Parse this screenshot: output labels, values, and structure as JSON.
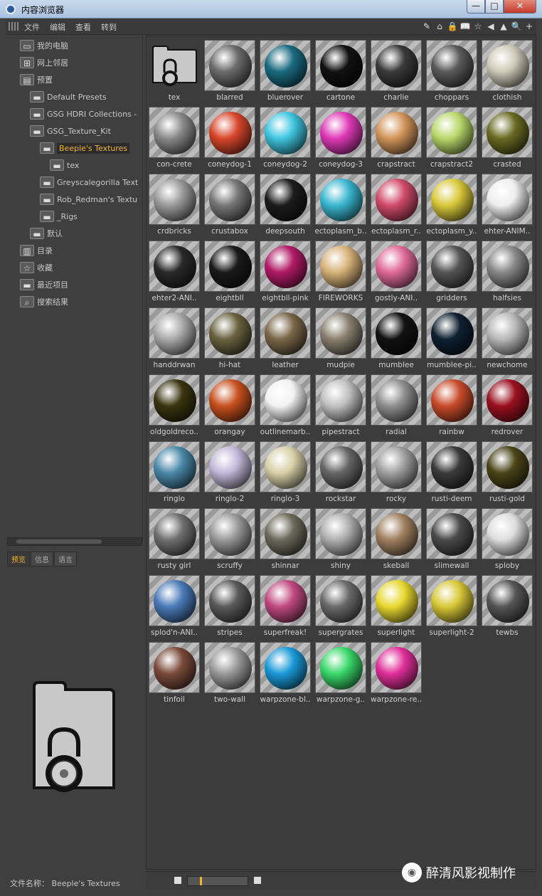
{
  "window": {
    "title": "内容浏览器",
    "min": "—",
    "max": "□",
    "close": "✕"
  },
  "menu": [
    "文件",
    "编辑",
    "查看",
    "转到"
  ],
  "toolbar_icons": [
    "edit-icon",
    "home-icon",
    "lock-icon",
    "book-icon",
    "star-icon",
    "back-icon",
    "up-icon",
    "search-icon",
    "new-icon"
  ],
  "toolbar_glyphs": [
    "✎",
    "⌂",
    "🔒",
    "📖",
    "☆",
    "◀",
    "▲",
    "🔍",
    "+"
  ],
  "tree": [
    {
      "label": "我的电脑",
      "level": 0,
      "icon": "computer-icon"
    },
    {
      "label": "网上邻居",
      "level": 0,
      "icon": "network-icon"
    },
    {
      "label": "预置",
      "level": 0,
      "icon": "presets-icon"
    },
    {
      "label": "Default Presets",
      "level": 1,
      "icon": "folder-icon"
    },
    {
      "label": "GSG HDRI Collections -",
      "level": 1,
      "icon": "folder-icon"
    },
    {
      "label": "GSG_Texture_Kit",
      "level": 1,
      "icon": "folder-icon"
    },
    {
      "label": "Beeple's Textures",
      "level": 2,
      "icon": "folder-icon",
      "selected": true
    },
    {
      "label": "tex",
      "level": 3,
      "icon": "folder-icon"
    },
    {
      "label": "Greyscalegorilla Text",
      "level": 2,
      "icon": "folder-icon"
    },
    {
      "label": "Rob_Redman's Textu",
      "level": 2,
      "icon": "folder-icon"
    },
    {
      "label": "_Rigs",
      "level": 2,
      "icon": "folder-icon"
    },
    {
      "label": "默认",
      "level": 1,
      "icon": "folder-icon"
    },
    {
      "label": "目录",
      "level": 0,
      "icon": "catalog-icon"
    },
    {
      "label": "收藏",
      "level": 0,
      "icon": "favorites-icon"
    },
    {
      "label": "最近项目",
      "level": 0,
      "icon": "recent-icon"
    },
    {
      "label": "搜索结果",
      "level": 0,
      "icon": "search-results-icon"
    }
  ],
  "tabs": [
    {
      "label": "预览",
      "active": true
    },
    {
      "label": "信息",
      "active": false
    },
    {
      "label": "语言",
      "active": false
    }
  ],
  "file_label": "文件名称：  Beeple's Textures",
  "items": [
    {
      "label": "tex",
      "c": "#cccccc",
      "folder": true
    },
    {
      "label": "blarred",
      "c": "#6b6b6b"
    },
    {
      "label": "bluerover",
      "c": "#1a6a80"
    },
    {
      "label": "cartone",
      "c": "#111111"
    },
    {
      "label": "charlie",
      "c": "#3a3a3a"
    },
    {
      "label": "choppars",
      "c": "#5a5a5a"
    },
    {
      "label": "clothish",
      "c": "#cfc9b8"
    },
    {
      "label": "con-crete",
      "c": "#8a8a8a"
    },
    {
      "label": "coneydog-1",
      "c": "#d8462a"
    },
    {
      "label": "coneydog-2",
      "c": "#3fc6e0"
    },
    {
      "label": "coneydog-3",
      "c": "#e03ab8"
    },
    {
      "label": "crapstract",
      "c": "#d2955a"
    },
    {
      "label": "crapstract2",
      "c": "#b9d86a"
    },
    {
      "label": "crasted",
      "c": "#6a6a22"
    },
    {
      "label": "crdbricks",
      "c": "#9a9a9a"
    },
    {
      "label": "crustabox",
      "c": "#777777"
    },
    {
      "label": "deepsouth",
      "c": "#1c1c1c"
    },
    {
      "label": "ectoplasm_b..",
      "c": "#3ab7d0"
    },
    {
      "label": "ectoplasm_r..",
      "c": "#d04a6a"
    },
    {
      "label": "ectoplasm_y..",
      "c": "#d8c83a"
    },
    {
      "label": "ehter-ANIM..",
      "c": "#eeeeee"
    },
    {
      "label": "ehter2-ANI..",
      "c": "#2a2a2a"
    },
    {
      "label": "eightbll",
      "c": "#1a1a1a"
    },
    {
      "label": "eightbll-pink",
      "c": "#b01a66"
    },
    {
      "label": "FIREWORKS",
      "c": "#d8b27a"
    },
    {
      "label": "gostly-ANI..",
      "c": "#e06a9a"
    },
    {
      "label": "gridders",
      "c": "#555555"
    },
    {
      "label": "halfsies",
      "c": "#888888"
    },
    {
      "label": "handdrwan",
      "c": "#aaaaaa"
    },
    {
      "label": "hi-hat",
      "c": "#6a6240"
    },
    {
      "label": "leather",
      "c": "#7a6648"
    },
    {
      "label": "mudpie",
      "c": "#8a8070"
    },
    {
      "label": "mumblee",
      "c": "#121212"
    },
    {
      "label": "mumblee-pi..",
      "c": "#0e2030"
    },
    {
      "label": "newchome",
      "c": "#b8b8b8"
    },
    {
      "label": "oldgoldreco..",
      "c": "#3a3410"
    },
    {
      "label": "orangay",
      "c": "#c8501e"
    },
    {
      "label": "outlinemarb..",
      "c": "#f2f2f2"
    },
    {
      "label": "pipestract",
      "c": "#c0c0c0"
    },
    {
      "label": "radial",
      "c": "#8e8e8e"
    },
    {
      "label": "rainbw",
      "c": "#c84a2a"
    },
    {
      "label": "redrover",
      "c": "#9a1020"
    },
    {
      "label": "ringlo",
      "c": "#4a88a8"
    },
    {
      "label": "ringlo-2",
      "c": "#c0b8d8"
    },
    {
      "label": "ringlo-3",
      "c": "#d8d0a8"
    },
    {
      "label": "rockstar",
      "c": "#666666"
    },
    {
      "label": "rocky",
      "c": "#a0a0a0"
    },
    {
      "label": "rusti-deem",
      "c": "#3a3a3a"
    },
    {
      "label": "rusti-gold",
      "c": "#4a4418"
    },
    {
      "label": "rusty girl",
      "c": "#707070"
    },
    {
      "label": "scruffy",
      "c": "#9a9a9a"
    },
    {
      "label": "shinnar",
      "c": "#6a6a5a"
    },
    {
      "label": "shiny",
      "c": "#b0b0b0"
    },
    {
      "label": "skeball",
      "c": "#a08060"
    },
    {
      "label": "slimewall",
      "c": "#4a4a4a"
    },
    {
      "label": "sploby",
      "c": "#dddddd"
    },
    {
      "label": "splod'n-ANI..",
      "c": "#4a7ab8"
    },
    {
      "label": "stripes",
      "c": "#5a5a5a"
    },
    {
      "label": "superfreak!",
      "c": "#c04a80"
    },
    {
      "label": "supergrates",
      "c": "#6a6a6a"
    },
    {
      "label": "superlight",
      "c": "#e8d830"
    },
    {
      "label": "superlight-2",
      "c": "#d8c838"
    },
    {
      "label": "tewbs",
      "c": "#555555"
    },
    {
      "label": "tinfoil",
      "c": "#7a4a3a"
    },
    {
      "label": "two-wall",
      "c": "#9a9a9a"
    },
    {
      "label": "warpzone-bl..",
      "c": "#1a9ad8"
    },
    {
      "label": "warpzone-g..",
      "c": "#3ad86a"
    },
    {
      "label": "warpzone-re..",
      "c": "#e0309a"
    }
  ],
  "zoom_level": 0.2,
  "watermark": {
    "text": "醉清风影视制作",
    "icon": "wechat-icon",
    "glyph": "◉"
  }
}
